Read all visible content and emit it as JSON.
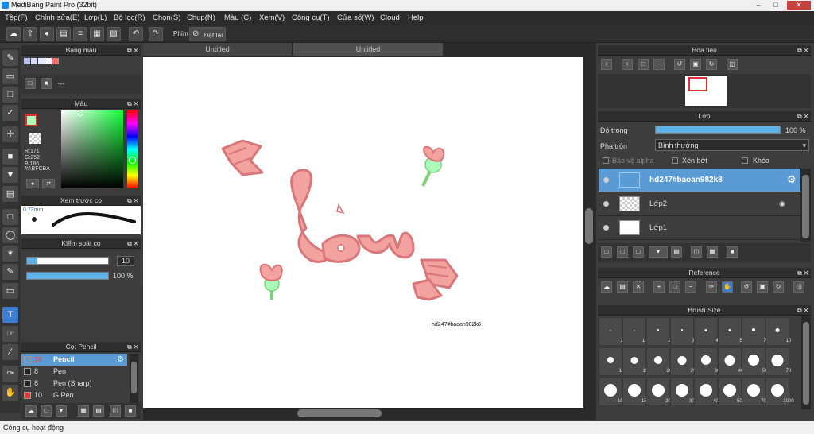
{
  "window": {
    "title": "MediBang Paint Pro (32bit)"
  },
  "menu": [
    "Tệp(F)",
    "Chỉnh sửa(E)",
    "Lớp(L)",
    "Bộ lọc(R)",
    "Chọn(S)",
    "Chụp(N)",
    "Màu (C)",
    "Xem(V)",
    "Công cụ(T)",
    "Cửa sổ(W)",
    "Cloud",
    "Help"
  ],
  "toolbar": {
    "shortcut_label": "Phím",
    "reset_label": "Đặt lại"
  },
  "palette": {
    "title": "Bảng màu",
    "info": "---"
  },
  "color": {
    "title": "Màu",
    "r": "R:171",
    "g": "G:252",
    "b": "B:186",
    "hex": "#ABFCBA",
    "accent": "#ABFCBA"
  },
  "preview": {
    "title": "Xem trước cọ",
    "size": "0.73mm"
  },
  "brush_control": {
    "title": "Kiểm soát cọ",
    "size_value": "10",
    "opacity_value": "100 %",
    "size_fraction": 0.13,
    "opacity_fraction": 1.0
  },
  "brushes": {
    "title": "Cọ: Pencil",
    "items": [
      {
        "size": "10",
        "name": "Pencil",
        "color": "#222222"
      },
      {
        "size": "8",
        "name": "Pen",
        "color": "#222222"
      },
      {
        "size": "8",
        "name": "Pen (Sharp)",
        "color": "#222222"
      },
      {
        "size": "10",
        "name": "G Pen",
        "color": "#ee3333"
      }
    ]
  },
  "tabs": [
    "Untitled",
    "Untitled"
  ],
  "canvas": {
    "watermark": "hd247#baoan982k8"
  },
  "navigator": {
    "title": "Hoa tiêu"
  },
  "layer": {
    "title": "Lớp",
    "opacity_label": "Độ trong",
    "opacity_value": "100 %",
    "opacity_fraction": 1.0,
    "blend_label": "Pha trộn",
    "blend_value": "Bình thường",
    "protect_alpha": "Bảo vệ alpha",
    "clipping": "Xén bớt",
    "lock": "Khóa",
    "layers": [
      {
        "name": "hd247#baoan982k8"
      },
      {
        "name": "Lớp2"
      },
      {
        "name": "Lớp1"
      }
    ]
  },
  "reference": {
    "title": "Reference"
  },
  "brush_size": {
    "title": "Brush Size",
    "sizes": [
      "1",
      "1.5",
      "2",
      "3",
      "4",
      "5",
      "7",
      "10",
      "12",
      "15",
      "20",
      "25",
      "30",
      "40",
      "50",
      "70",
      "100",
      "150",
      "200",
      "300",
      "400",
      "500",
      "700",
      "1000"
    ]
  },
  "status": {
    "text": "Công cụ hoạt động"
  }
}
